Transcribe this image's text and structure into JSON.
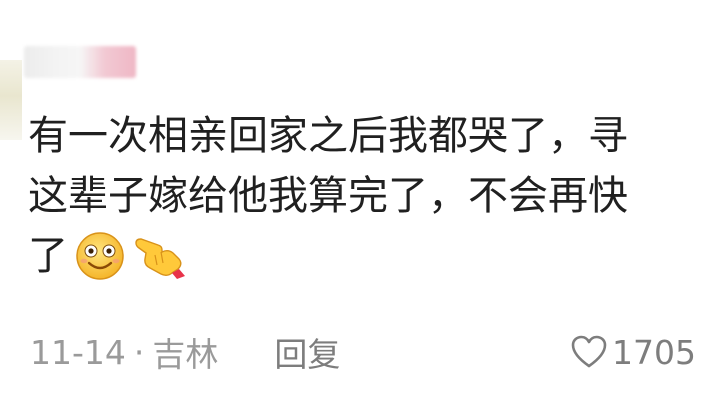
{
  "comment": {
    "lines": [
      "有一次相亲回家之后我都哭了，寻",
      "这辈子嫁给他我算完了，不会再快",
      "了"
    ],
    "emojis": [
      "smile-emoji",
      "pointing-hand-emoji"
    ]
  },
  "meta": {
    "date": "11-14",
    "separator": "·",
    "location": "吉林",
    "reply_label": "回复",
    "like_count": "1705",
    "like_icon": "heart-outline-icon"
  },
  "colors": {
    "text": "#202020",
    "meta_text": "#9a9a9a",
    "username_blur_pink": "#efb7c5"
  }
}
